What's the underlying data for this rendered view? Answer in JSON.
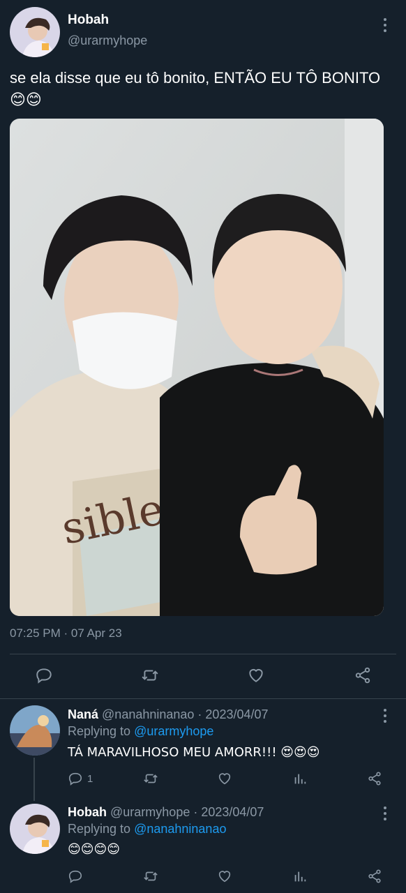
{
  "main_tweet": {
    "author_name": "Hobah",
    "author_handle": "@urarmyhope",
    "text": "se ela disse que eu tô bonito, ENTÃO EU TÔ BONITO 😊😊",
    "timestamp": "07:25 PM · 07 Apr 23"
  },
  "replies": [
    {
      "author_name": "Naná",
      "meta": "@nanahninanao · 2023/04/07",
      "replying_prefix": "Replying to",
      "replying_to": "@urarmyhope",
      "text": "TÁ MARAVILHOSO MEU AMORR!!! 😍😍😍",
      "reply_count": "1"
    },
    {
      "author_name": "Hobah",
      "meta": "@urarmyhope · 2023/04/07",
      "replying_prefix": "Replying to",
      "replying_to": "@nanahninanao",
      "text": "😊😊😊😊",
      "reply_count": ""
    }
  ],
  "icons": {
    "reply": "reply-icon",
    "retweet": "retweet-icon",
    "like": "heart-icon",
    "share": "share-icon",
    "analytics": "analytics-icon",
    "more": "more-options-icon"
  },
  "colors": {
    "background": "#15202b",
    "link": "#1d9bf0",
    "muted": "#8b98a5",
    "divider": "#38444d"
  }
}
